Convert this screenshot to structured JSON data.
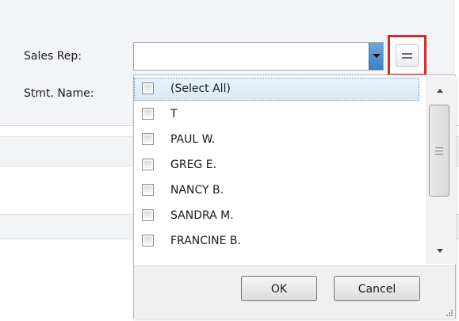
{
  "form": {
    "sales_rep_label": "Sales Rep:",
    "stmt_name_label": "Stmt. Name:",
    "sales_rep_value": "",
    "equals_button_icon": "equals-icon"
  },
  "dropdown": {
    "items": [
      {
        "label": "(Select All)",
        "checked": false,
        "selected": true
      },
      {
        "label": "T",
        "checked": false
      },
      {
        "label": "PAUL W.",
        "checked": false
      },
      {
        "label": "GREG E.",
        "checked": false
      },
      {
        "label": "NANCY B.",
        "checked": false
      },
      {
        "label": "SANDRA M.",
        "checked": false
      },
      {
        "label": "FRANCINE B.",
        "checked": false
      }
    ],
    "ok_label": "OK",
    "cancel_label": "Cancel"
  },
  "colors": {
    "highlight_border": "#e0242b",
    "dropdown_button": "#3d7fc2",
    "selection": "#d9e8f7"
  }
}
